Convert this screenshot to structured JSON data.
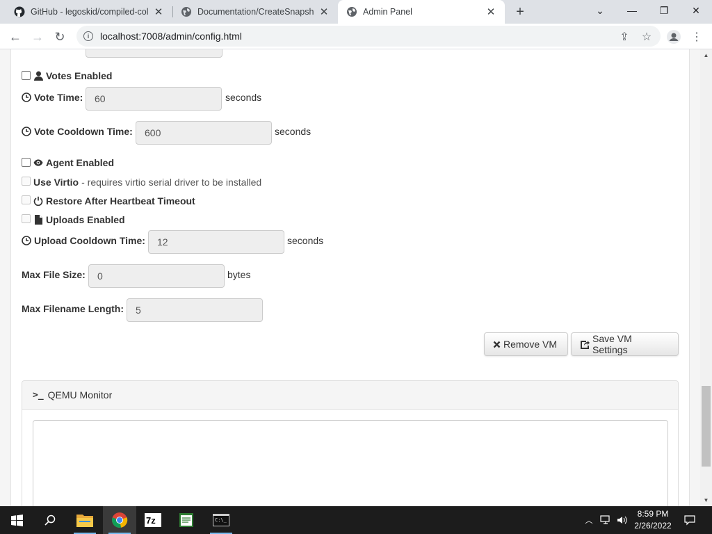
{
  "browser": {
    "tabs": [
      {
        "title": "GitHub - legoskid/compiled-colle",
        "icon": "github-icon"
      },
      {
        "title": "Documentation/CreateSnapshot",
        "icon": "globe-icon"
      },
      {
        "title": "Admin Panel",
        "icon": "globe-icon",
        "active": true
      }
    ],
    "url": "localhost:7008/admin/config.html"
  },
  "form": {
    "votes_enabled_label": "Votes Enabled",
    "vote_time_label": "Vote Time:",
    "vote_time_value": "60",
    "vote_cooldown_label": "Vote Cooldown Time:",
    "vote_cooldown_value": "600",
    "agent_enabled_label": "Agent Enabled",
    "use_virtio_label": "Use Virtio",
    "use_virtio_note": "- requires virtio serial driver to be installed",
    "restore_label": "Restore After Heartbeat Timeout",
    "uploads_enabled_label": "Uploads Enabled",
    "upload_cooldown_label": "Upload Cooldown Time:",
    "upload_cooldown_value": "12",
    "max_file_size_label": "Max File Size:",
    "max_file_size_value": "0",
    "max_filename_length_label": "Max Filename Length:",
    "max_filename_length_value": "5",
    "unit_seconds": "seconds",
    "unit_bytes": "bytes",
    "remove_vm_label": "Remove VM",
    "save_vm_label": "Save VM Settings"
  },
  "qemu_monitor": {
    "title": "QEMU Monitor"
  },
  "taskbar": {
    "time": "8:59 PM",
    "date": "2/26/2022",
    "apps": [
      "file-explorer-icon",
      "chrome-icon",
      "7zip-icon",
      "notepad-icon",
      "terminal-icon"
    ]
  }
}
